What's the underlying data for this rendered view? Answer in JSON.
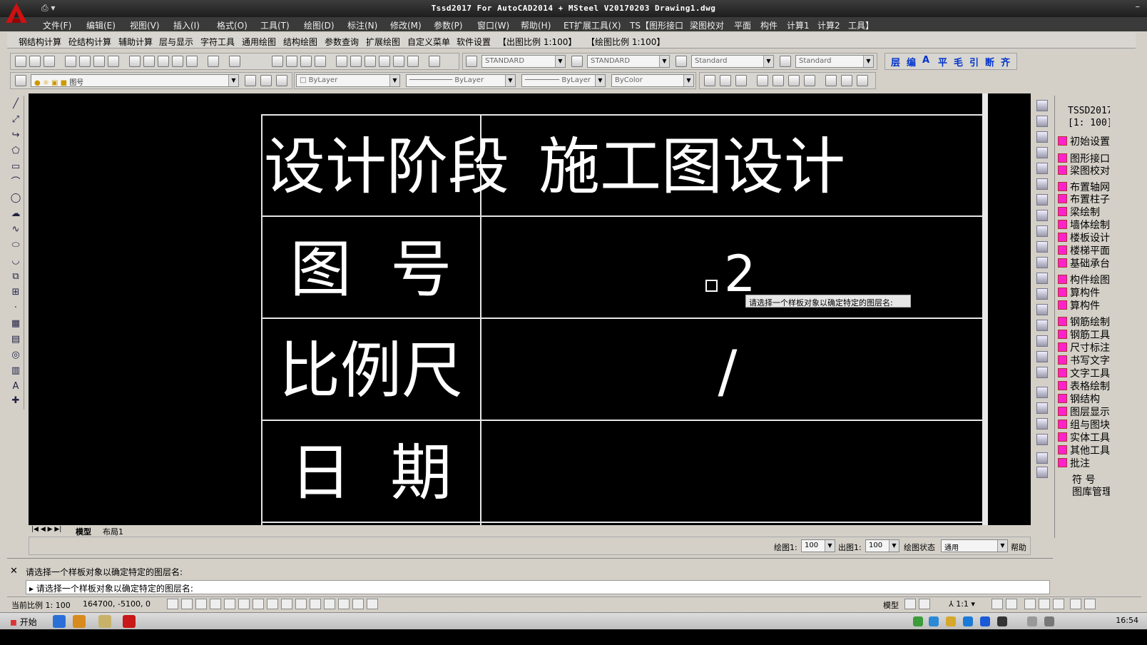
{
  "window": {
    "title": "Tssd2017 For AutoCAD2014 + MSteel V20170203     Drawing1.dwg",
    "qa_icon": "printer-icon",
    "controls": [
      "–",
      "□",
      "×"
    ]
  },
  "menubar": {
    "items": [
      "文件(F)",
      "编辑(E)",
      "视图(V)",
      "插入(I)",
      "格式(O)",
      "工具(T)",
      "绘图(D)",
      "标注(N)",
      "修改(M)",
      "参数(P)",
      "窗口(W)",
      "帮助(H)",
      "ET扩展工具(X)",
      "TS【图形接口",
      "梁图校对",
      "平面",
      "构件",
      "计算1",
      "计算2",
      "工具】"
    ]
  },
  "tssd_toolbar": {
    "items": [
      "钢结构计算",
      "砼结构计算",
      "辅助计算",
      "层与显示",
      "字符工具",
      "通用绘图",
      "结构绘图",
      "参数查询",
      "扩展绘图",
      "自定义菜单",
      "软件设置",
      "【出图比例 1:100】",
      "【绘图比例 1:100】"
    ]
  },
  "style_toolbar": {
    "text_style": "STANDARD",
    "dim_style": "STANDARD",
    "table_style": "Standard",
    "mleader_style": "Standard",
    "quick_tools": [
      "层",
      "编",
      "A",
      "平",
      "毛",
      "引",
      "断",
      "齐"
    ]
  },
  "layer_toolbar": {
    "layer": "图号",
    "color": "ByLayer",
    "linetype": "ByLayer",
    "lineweight": "ByLayer",
    "plotstyle": "ByColor"
  },
  "canvas": {
    "table": {
      "rows": [
        {
          "label": "设计阶段",
          "value": "施工图设计"
        },
        {
          "label": "图  号",
          "value": "2"
        },
        {
          "label": "比例尺",
          "value": "/"
        },
        {
          "label": "日  期",
          "value": ""
        }
      ]
    },
    "tooltip": "请选择一个样板对象以确定特定的图层名:"
  },
  "tabs": {
    "model": "模型",
    "layout": "布局1"
  },
  "draw_status": {
    "draw_scale_label": "绘图1:",
    "draw_scale_value": "100",
    "out_scale_label": "出图1:",
    "out_scale_value": "100",
    "state_label": "绘图状态",
    "state_value": "通用",
    "help": "帮助"
  },
  "right_panel": {
    "header1": "TSSD2017",
    "header2": "[1: 100]",
    "items": [
      "初始设置",
      "图形接口",
      "梁图校对",
      "布置轴网",
      "布置柱子",
      "梁绘制",
      "墙体绘制",
      "楼板设计",
      "楼梯平面",
      "基础承台",
      "构件绘图",
      "算构件",
      "算构件",
      "钢筋绘制",
      "钢筋工具",
      "尺寸标注",
      "书写文字",
      "文字工具",
      "表格绘制",
      "钢结构",
      "图层显示",
      "组与图块",
      "实体工具",
      "其他工具",
      "批注",
      "符 号",
      "图库管理"
    ]
  },
  "command": {
    "history": "请选择一个样板对象以确定特定的图层名:",
    "prompt": "请选择一个样板对象以确定特定的图层名:"
  },
  "status": {
    "scale_text": "当前比例 1: 100",
    "coords": "164700, -5100, 0",
    "model": "模型",
    "annoscale": "1:1"
  },
  "taskbar": {
    "start": "开始",
    "clock": "16:54"
  }
}
